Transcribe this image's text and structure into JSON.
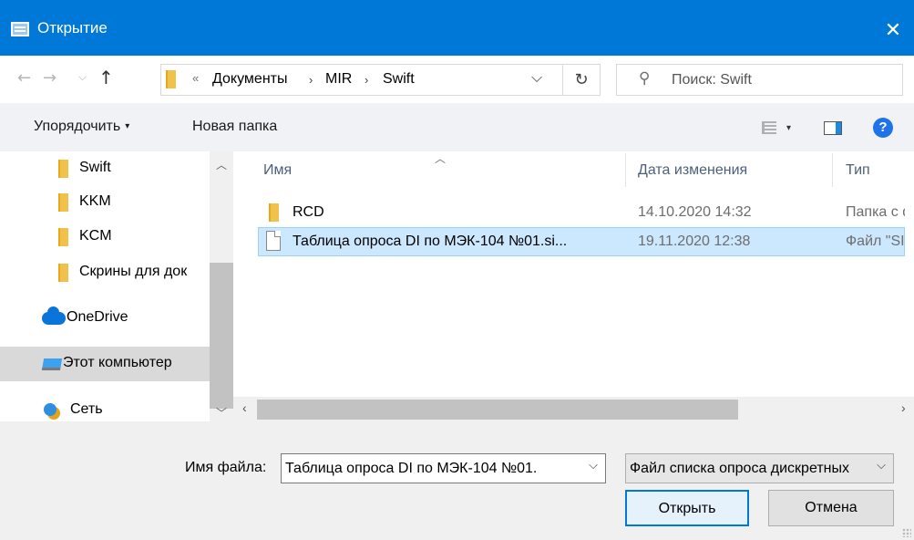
{
  "window": {
    "title": "Открытие",
    "close_glyph": "✕"
  },
  "address": {
    "overflow": "«",
    "crumbs": [
      "Документы",
      "MIR",
      "Swift"
    ],
    "separator": "›",
    "dropdown_glyph": "⌵",
    "refresh_glyph": "↻"
  },
  "search": {
    "placeholder": "Поиск: Swift"
  },
  "toolbar": {
    "organize_label": "Упорядочить",
    "new_folder_label": "Новая папка",
    "help_glyph": "?"
  },
  "nav_pane": {
    "folders": [
      "Swift",
      "KKM",
      "KCM",
      "Скрины для док"
    ],
    "onedrive": "OneDrive",
    "this_pc": "Этот компьютер",
    "network": "Сеть"
  },
  "file_list": {
    "columns": {
      "name": "Имя",
      "date": "Дата изменения",
      "type": "Тип"
    },
    "rows": [
      {
        "name": "RCD",
        "date": "14.10.2020 14:32",
        "type": "Папка с файлами",
        "kind": "folder",
        "selected": false
      },
      {
        "name": "Таблица опроса DI по МЭК-104 №01.si...",
        "date": "19.11.2020 12:38",
        "type": "Файл \"SIL\"",
        "kind": "file",
        "selected": true
      }
    ]
  },
  "bottom": {
    "filename_label": "Имя файла:",
    "filename_value": "Таблица опроса DI по МЭК-104 №01.",
    "filter_value": "Файл списка опроса дискретных",
    "open_label": "Открыть",
    "cancel_label": "Отмена"
  },
  "colors": {
    "accent": "#0078d7",
    "selection": "#cce8ff",
    "folder": "#f0c24b"
  }
}
